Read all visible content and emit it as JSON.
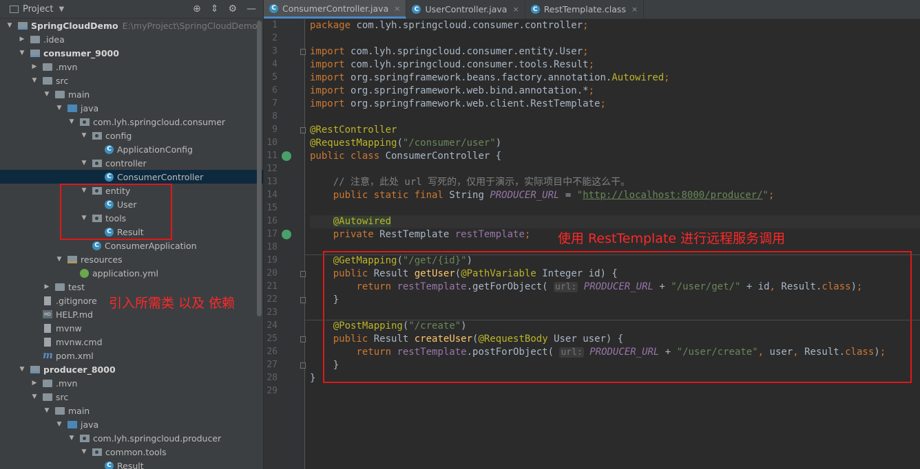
{
  "project_panel": {
    "title": "Project",
    "tree": [
      {
        "label": "SpringCloudDemo",
        "path": "E:\\myProject\\SpringCloudDemo",
        "level": 0,
        "expanded": true,
        "icon": "folder-module",
        "bold": true
      },
      {
        "label": ".idea",
        "level": 1,
        "expanded": false,
        "icon": "folder"
      },
      {
        "label": "consumer_9000",
        "level": 1,
        "expanded": true,
        "icon": "folder-module",
        "bold": true
      },
      {
        "label": ".mvn",
        "level": 2,
        "expanded": false,
        "icon": "folder"
      },
      {
        "label": "src",
        "level": 2,
        "expanded": true,
        "icon": "folder"
      },
      {
        "label": "main",
        "level": 3,
        "expanded": true,
        "icon": "folder"
      },
      {
        "label": "java",
        "level": 4,
        "expanded": true,
        "icon": "folder-src"
      },
      {
        "label": "com.lyh.springcloud.consumer",
        "level": 5,
        "expanded": true,
        "icon": "package"
      },
      {
        "label": "config",
        "level": 6,
        "expanded": true,
        "icon": "package"
      },
      {
        "label": "ApplicationConfig",
        "level": 7,
        "icon": "class"
      },
      {
        "label": "controller",
        "level": 6,
        "expanded": true,
        "icon": "package"
      },
      {
        "label": "ConsumerController",
        "level": 7,
        "icon": "class",
        "selected": true
      },
      {
        "label": "entity",
        "level": 6,
        "expanded": true,
        "icon": "package"
      },
      {
        "label": "User",
        "level": 7,
        "icon": "class"
      },
      {
        "label": "tools",
        "level": 6,
        "expanded": true,
        "icon": "package"
      },
      {
        "label": "Result",
        "level": 7,
        "icon": "class"
      },
      {
        "label": "ConsumerApplication",
        "level": 6,
        "icon": "class"
      },
      {
        "label": "resources",
        "level": 4,
        "expanded": true,
        "icon": "res"
      },
      {
        "label": "application.yml",
        "level": 5,
        "icon": "yml"
      },
      {
        "label": "test",
        "level": 3,
        "expanded": false,
        "icon": "folder"
      },
      {
        "label": ".gitignore",
        "level": 2,
        "icon": "file"
      },
      {
        "label": "HELP.md",
        "level": 2,
        "icon": "md"
      },
      {
        "label": "mvnw",
        "level": 2,
        "icon": "file"
      },
      {
        "label": "mvnw.cmd",
        "level": 2,
        "icon": "file"
      },
      {
        "label": "pom.xml",
        "level": 2,
        "icon": "maven"
      },
      {
        "label": "producer_8000",
        "level": 1,
        "expanded": true,
        "icon": "folder-module",
        "bold": true
      },
      {
        "label": ".mvn",
        "level": 2,
        "expanded": false,
        "icon": "folder"
      },
      {
        "label": "src",
        "level": 2,
        "expanded": true,
        "icon": "folder"
      },
      {
        "label": "main",
        "level": 3,
        "expanded": true,
        "icon": "folder"
      },
      {
        "label": "java",
        "level": 4,
        "expanded": true,
        "icon": "folder-src"
      },
      {
        "label": "com.lyh.springcloud.producer",
        "level": 5,
        "expanded": true,
        "icon": "package"
      },
      {
        "label": "common.tools",
        "level": 6,
        "expanded": true,
        "icon": "package"
      },
      {
        "label": "Result",
        "level": 7,
        "icon": "class"
      }
    ]
  },
  "annotations": {
    "left_note": "引入所需类 以及 依赖",
    "right_note": "使用 RestTemplate 进行远程服务调用",
    "color": "#ff2828"
  },
  "tabs": [
    {
      "label": "ConsumerController.java",
      "active": true
    },
    {
      "label": "UserController.java",
      "active": false
    },
    {
      "label": "RestTemplate.class",
      "active": false
    }
  ],
  "code": {
    "current_line": 16,
    "lines": [
      [
        [
          "kw",
          "package "
        ],
        [
          "",
          "com.lyh.springcloud.consumer.controller"
        ],
        [
          "kw",
          ";"
        ]
      ],
      [],
      [
        [
          "kw",
          "import "
        ],
        [
          "",
          "com.lyh.springcloud.consumer.entity.User"
        ],
        [
          "kw",
          ";"
        ]
      ],
      [
        [
          "kw",
          "import "
        ],
        [
          "",
          "com.lyh.springcloud.consumer.tools.Result"
        ],
        [
          "kw",
          ";"
        ]
      ],
      [
        [
          "kw",
          "import "
        ],
        [
          "",
          "org.springframework.beans.factory.annotation."
        ],
        [
          "ann",
          "Autowired"
        ],
        [
          "kw",
          ";"
        ]
      ],
      [
        [
          "kw",
          "import "
        ],
        [
          "",
          "org.springframework.web.bind.annotation.*"
        ],
        [
          "kw",
          ";"
        ]
      ],
      [
        [
          "kw",
          "import "
        ],
        [
          "",
          "org.springframework.web.client.RestTemplate"
        ],
        [
          "kw",
          ";"
        ]
      ],
      [],
      [
        [
          "ann",
          "@RestController"
        ]
      ],
      [
        [
          "ann",
          "@RequestMapping"
        ],
        [
          "",
          "("
        ],
        [
          "str",
          "\"/consumer/user\""
        ],
        [
          "",
          ")"
        ]
      ],
      [
        [
          "kw",
          "public class "
        ],
        [
          "",
          "ConsumerController {"
        ]
      ],
      [],
      [
        [
          "",
          "    "
        ],
        [
          "cmt",
          "// 注意，此处 url 写死的，仅用于演示，实际项目中不能这么干。"
        ]
      ],
      [
        [
          "",
          "    "
        ],
        [
          "kw",
          "public static final "
        ],
        [
          "",
          "String "
        ],
        [
          "const",
          "PRODUCER_URL"
        ],
        [
          "",
          " = "
        ],
        [
          "str",
          "\""
        ],
        [
          "url",
          "http://localhost:8000/producer/"
        ],
        [
          "str",
          "\""
        ],
        [
          "kw",
          ";"
        ]
      ],
      [],
      [
        [
          "",
          "    "
        ],
        [
          "autow",
          "@Autowired"
        ]
      ],
      [
        [
          "",
          "    "
        ],
        [
          "kw",
          "private "
        ],
        [
          "",
          "RestTemplate "
        ],
        [
          "field",
          "restTemplate"
        ],
        [
          "kw",
          ";"
        ]
      ],
      [],
      [
        [
          "",
          "    "
        ],
        [
          "ann",
          "@GetMapping"
        ],
        [
          "",
          "("
        ],
        [
          "str",
          "\"/get/{id}\""
        ],
        [
          "",
          ")"
        ]
      ],
      [
        [
          "",
          "    "
        ],
        [
          "kw",
          "public "
        ],
        [
          "",
          "Result "
        ],
        [
          "fn",
          "getUser"
        ],
        [
          "",
          "("
        ],
        [
          "ann",
          "@PathVariable "
        ],
        [
          "",
          "Integer id) {"
        ]
      ],
      [
        [
          "",
          "        "
        ],
        [
          "kw",
          "return "
        ],
        [
          "field",
          "restTemplate"
        ],
        [
          "",
          ".getForObject( "
        ],
        [
          "hint",
          "url:"
        ],
        [
          "const",
          " PRODUCER_URL"
        ],
        [
          "",
          " + "
        ],
        [
          "str",
          "\"/user/get/\""
        ],
        [
          "",
          " + id"
        ],
        [
          "kw",
          ", "
        ],
        [
          "",
          "Result."
        ],
        [
          "kw",
          "class"
        ],
        [
          "",
          ")"
        ],
        [
          "kw",
          ";"
        ]
      ],
      [
        [
          "",
          "    }"
        ]
      ],
      [],
      [
        [
          "",
          "    "
        ],
        [
          "ann",
          "@PostMapping"
        ],
        [
          "",
          "("
        ],
        [
          "str",
          "\"/create\""
        ],
        [
          "",
          ")"
        ]
      ],
      [
        [
          "",
          "    "
        ],
        [
          "kw",
          "public "
        ],
        [
          "",
          "Result "
        ],
        [
          "fn",
          "createUser"
        ],
        [
          "",
          "("
        ],
        [
          "ann",
          "@RequestBody "
        ],
        [
          "",
          "User user) {"
        ]
      ],
      [
        [
          "",
          "        "
        ],
        [
          "kw",
          "return "
        ],
        [
          "field",
          "restTemplate"
        ],
        [
          "",
          ".postForObject( "
        ],
        [
          "hint",
          "url:"
        ],
        [
          "const",
          " PRODUCER_URL"
        ],
        [
          "",
          " + "
        ],
        [
          "str",
          "\"/user/create\""
        ],
        [
          "kw",
          ", "
        ],
        [
          "",
          "user"
        ],
        [
          "kw",
          ", "
        ],
        [
          "",
          "Result."
        ],
        [
          "kw",
          "class"
        ],
        [
          "",
          ")"
        ],
        [
          "kw",
          ";"
        ]
      ],
      [
        [
          "",
          "    }"
        ]
      ],
      [
        [
          "",
          "}"
        ]
      ],
      []
    ]
  }
}
